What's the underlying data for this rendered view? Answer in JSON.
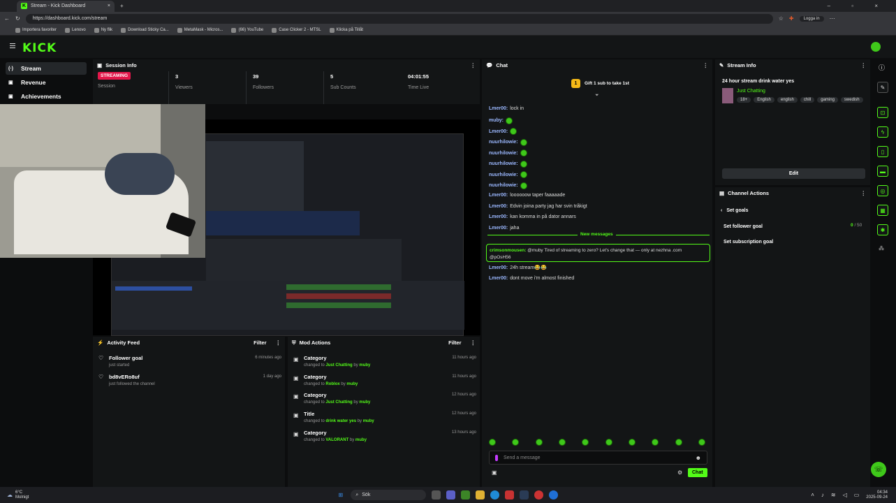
{
  "browser": {
    "tab_title": "Stream - Kick Dashboard",
    "url": "https://dashboard.kick.com/stream",
    "login": "Logga in",
    "bookmarks": [
      "Importera favoriter",
      "Lenovo",
      "Ny flik",
      "Download Sticky Ca...",
      "MetaMask - Micros...",
      "(66) YouTube",
      "Case Clicker 2 - MTSL",
      "Klicka på Tillåt"
    ]
  },
  "app": {
    "logo": "KICK",
    "nav": [
      {
        "label": "Stream",
        "icon": "(·)"
      },
      {
        "label": "Revenue",
        "icon": "▣"
      },
      {
        "label": "Achievements",
        "icon": "▣"
      }
    ],
    "session": {
      "title": "Session Info",
      "badge": "STREAMING",
      "badge_label": "Session",
      "stats": [
        {
          "value": "3",
          "label": "Viewers"
        },
        {
          "value": "39",
          "label": "Followers"
        },
        {
          "value": "5",
          "label": "Sub Counts"
        },
        {
          "value": "04:01:55",
          "label": "Time Live"
        }
      ]
    },
    "activity": {
      "title": "Activity Feed",
      "filter": "Filter",
      "items": [
        {
          "title": "Follower goal",
          "sub": "just started",
          "time": "6 minutes ago"
        },
        {
          "title": "bd8vERo8uf",
          "sub": "just followed the channel",
          "time": "1 day ago"
        }
      ]
    },
    "mod": {
      "title": "Mod Actions",
      "filter": "Filter",
      "items": [
        {
          "title": "Category",
          "pre": "changed to ",
          "val": "Just Chatting",
          "by": " by ",
          "user": "muby",
          "time": "11 hours ago"
        },
        {
          "title": "Category",
          "pre": "changed to ",
          "val": "Roblox",
          "by": " by ",
          "user": "muby",
          "time": "11 hours ago"
        },
        {
          "title": "Category",
          "pre": "changed to ",
          "val": "Just Chatting",
          "by": " by ",
          "user": "muby",
          "time": "12 hours ago"
        },
        {
          "title": "Title",
          "pre": "changed to ",
          "val": "drink water yes",
          "by": " by ",
          "user": "muby",
          "time": "12 hours ago"
        },
        {
          "title": "Category",
          "pre": "changed to ",
          "val": "VALORANT",
          "by": " by ",
          "user": "muby",
          "time": "13 hours ago"
        }
      ]
    },
    "chat": {
      "title": "Chat",
      "gift": "Gift 1 sub to take 1st",
      "new_messages": "New messages",
      "placeholder": "Send a message",
      "send": "Chat",
      "messages": [
        {
          "user": "Lmer00:",
          "text": "lock in"
        },
        {
          "user": "muby:",
          "text": ""
        },
        {
          "user": "Lmer00:",
          "text": ""
        },
        {
          "user": "nuurhilowie:",
          "text": ""
        },
        {
          "user": "nuurhilowie:",
          "text": ""
        },
        {
          "user": "nuurhilowie:",
          "text": ""
        },
        {
          "user": "nuurhilowie:",
          "text": ""
        },
        {
          "user": "nuurhilowie:",
          "text": ""
        },
        {
          "user": "Lmer00:",
          "text": "loooooow taper faaaaade"
        },
        {
          "user": "Lmer00:",
          "text": "Edvin joina party jag har svin tråkigt"
        },
        {
          "user": "Lmer00:",
          "text": "kan komma in på dator annars"
        },
        {
          "user": "Lmer00:",
          "text": "jaha"
        }
      ],
      "highlight": {
        "user": "crimsonmousen:",
        "text": "@muby Tired of streaming to zero? Let's change that — only at nezhna .com",
        "text2": "@pOsH56"
      },
      "after": [
        {
          "user": "Lmer00:",
          "text": "24h stream😂😂"
        },
        {
          "user": "Lmer00:",
          "text": "dont move i'm almost finished"
        }
      ]
    },
    "stream_info": {
      "title": "Stream Info",
      "stream_title": "24 hour stream drink water yes",
      "category": "Just Chatting",
      "tags": [
        "18+",
        "English",
        "english",
        "chill",
        "gaming",
        "swedish"
      ],
      "edit": "Edit"
    },
    "channel_actions": {
      "title": "Channel Actions",
      "back": "Set goals",
      "follower_goal": "Set follower goal",
      "follower_value": "0",
      "follower_total": "/ 50",
      "sub_goal": "Set subscription goal"
    }
  },
  "taskbar": {
    "weather_temp": "6°C",
    "weather_desc": "Molnigt",
    "search": "Sök",
    "time": "04:34",
    "date": "2025-09-24"
  },
  "colors": {
    "accent": "#53fc18",
    "live": "#e3174a",
    "panel": "#131516"
  }
}
